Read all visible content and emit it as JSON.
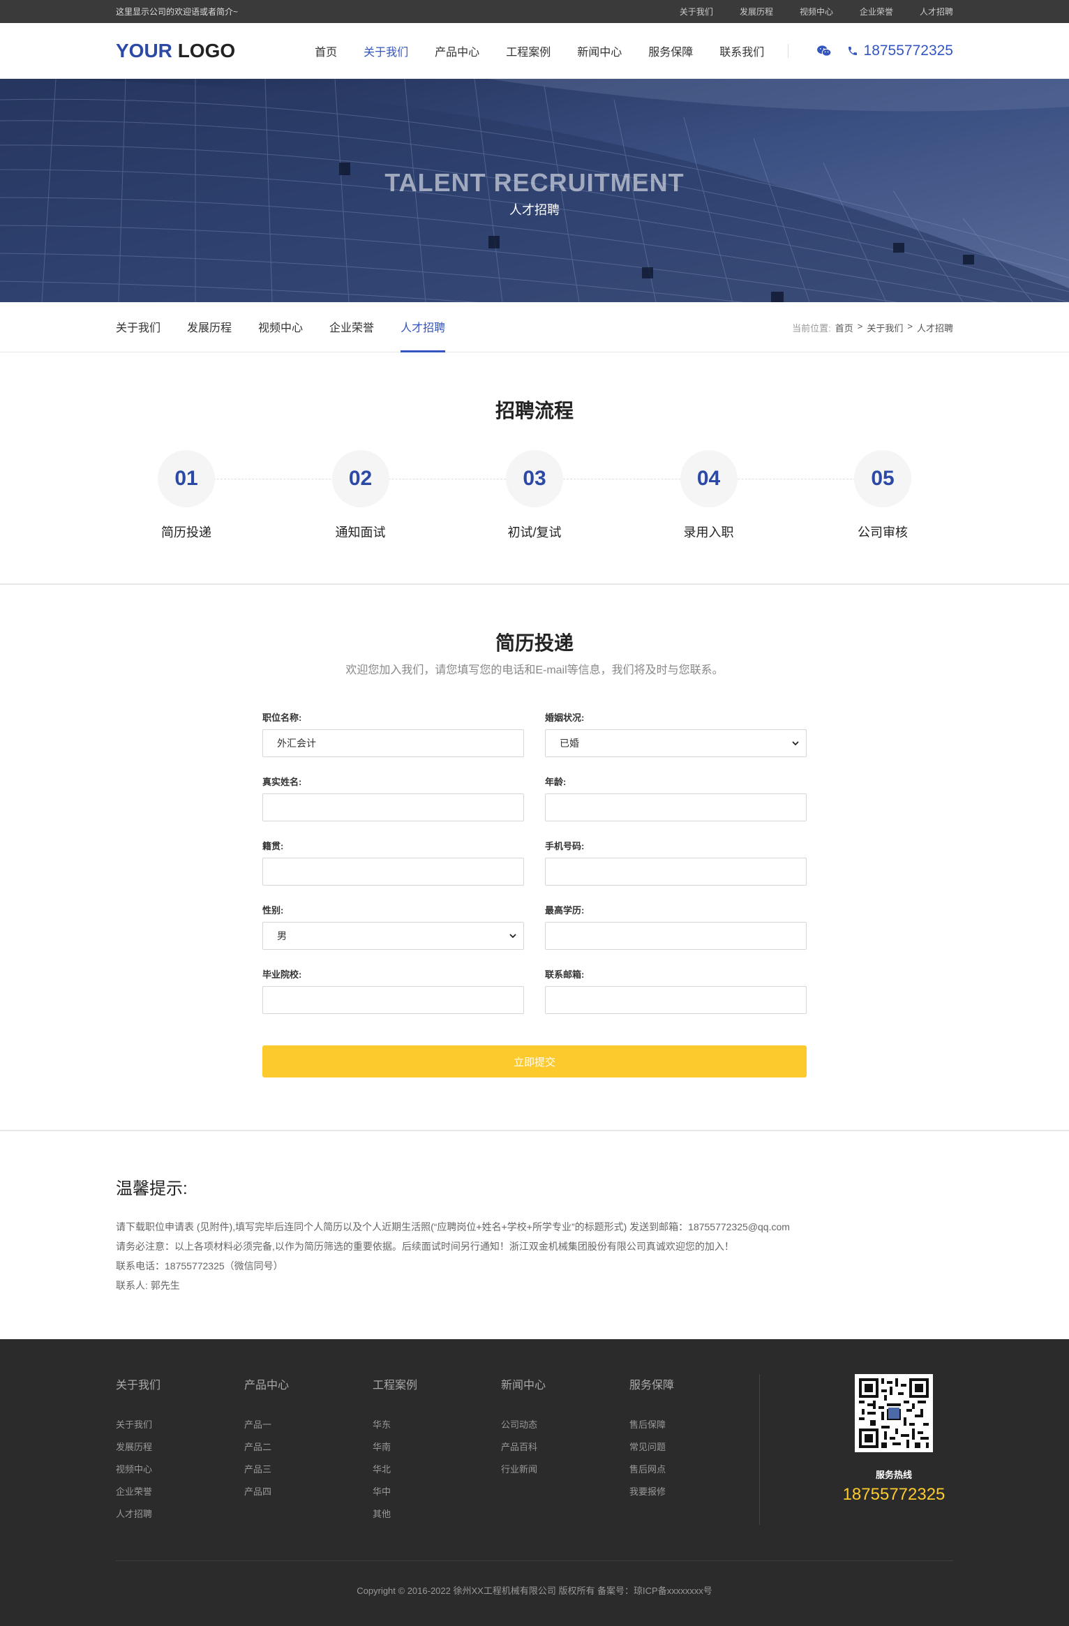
{
  "topbar": {
    "welcome": "这里显示公司的欢迎语或者简介~",
    "links": [
      "关于我们",
      "发展历程",
      "视频中心",
      "企业荣誉",
      "人才招聘"
    ]
  },
  "header": {
    "logo_a": "YOUR",
    "logo_b": "LOGO",
    "nav": [
      "首页",
      "关于我们",
      "产品中心",
      "工程案例",
      "新闻中心",
      "服务保障",
      "联系我们"
    ],
    "active_nav": "关于我们",
    "phone": "18755772325",
    "accent": "#3355c0"
  },
  "banner": {
    "title_en": "TALENT RECRUITMENT",
    "title_cn": "人才招聘"
  },
  "subnav": {
    "tabs": [
      "关于我们",
      "发展历程",
      "视频中心",
      "企业荣誉",
      "人才招聘"
    ],
    "active": "人才招聘",
    "crumb_label": "当前位置:",
    "crumb": [
      "首页",
      "关于我们",
      "人才招聘"
    ],
    "sep": ">"
  },
  "process": {
    "title": "招聘流程",
    "steps": [
      {
        "num": "01",
        "label": "简历投递"
      },
      {
        "num": "02",
        "label": "通知面试"
      },
      {
        "num": "03",
        "label": "初试/复试"
      },
      {
        "num": "04",
        "label": "录用入职"
      },
      {
        "num": "05",
        "label": "公司审核"
      }
    ]
  },
  "form": {
    "title": "简历投递",
    "subtitle": "欢迎您加入我们，请您填写您的电话和E-mail等信息，我们将及时与您联系。",
    "fields": {
      "position": {
        "label": "职位名称:",
        "value": "外汇会计"
      },
      "marital": {
        "label": "婚姻状况:",
        "value": "已婚"
      },
      "name": {
        "label": "真实姓名:",
        "value": ""
      },
      "age": {
        "label": "年龄:",
        "value": ""
      },
      "origin": {
        "label": "籍贯:",
        "value": ""
      },
      "mobile": {
        "label": "手机号码:",
        "value": ""
      },
      "gender": {
        "label": "性别:",
        "value": "男"
      },
      "education": {
        "label": "最高学历:",
        "value": ""
      },
      "school": {
        "label": "毕业院校:",
        "value": ""
      },
      "email": {
        "label": "联系邮箱:",
        "value": ""
      }
    },
    "submit": "立即提交",
    "submit_color": "#fdca2e"
  },
  "tips": {
    "title": "温馨提示:",
    "lines": [
      "请下载职位申请表 (见附件),填写完毕后连同个人简历以及个人近期生活照(“应聘岗位+姓名+学校+所学专业”的标题形式) 发送到邮箱：18755772325@qq.com",
      "请务必注意：以上各项材料必须完备,以作为简历筛选的重要依据。后续面试时间另行通知！浙江双金机械集团股份有限公司真诚欢迎您的加入！",
      "联系电话：18755772325（微信同号）",
      "联系人: 郭先生"
    ]
  },
  "footer": {
    "cols": [
      {
        "title": "关于我们",
        "items": [
          "关于我们",
          "发展历程",
          "视频中心",
          "企业荣誉",
          "人才招聘"
        ]
      },
      {
        "title": "产品中心",
        "items": [
          "产品一",
          "产品二",
          "产品三",
          "产品四"
        ]
      },
      {
        "title": "工程案例",
        "items": [
          "华东",
          "华南",
          "华北",
          "华中",
          "其他"
        ]
      },
      {
        "title": "新闻中心",
        "items": [
          "公司动态",
          "产品百科",
          "行业新闻"
        ]
      },
      {
        "title": "服务保障",
        "items": [
          "售后保障",
          "常见问题",
          "售后网点",
          "我要报修"
        ]
      }
    ],
    "hotline_label": "服务热线",
    "hotline": "18755772325",
    "copyright": "Copyright © 2016-2022 徐州XX工程机械有限公司 版权所有 备案号：琼ICP备xxxxxxxx号"
  }
}
